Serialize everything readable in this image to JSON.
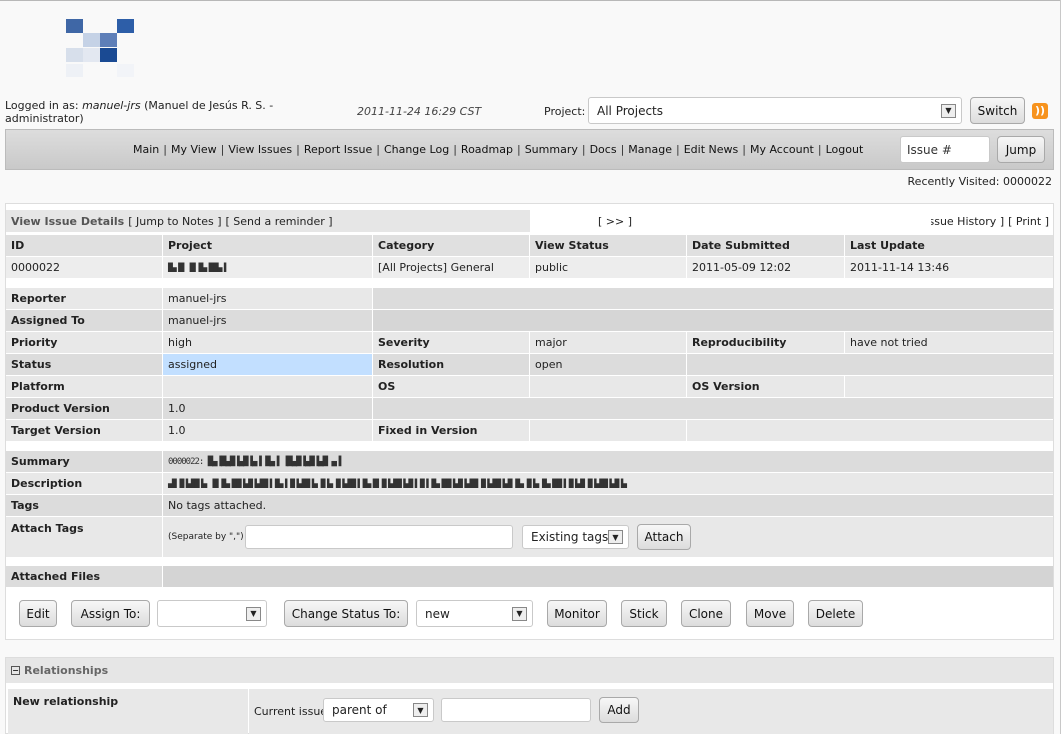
{
  "header": {
    "login_prefix": "Logged in as: ",
    "login_user": "manuel-jrs",
    "login_rest": " (Manuel de Jesús R. S. - administrator)",
    "timestamp": "2011-11-24 16:29 CST",
    "project_label": "Project:",
    "project_selected": "All Projects",
    "switch_label": "Switch"
  },
  "menu": {
    "items": [
      "Main",
      "My View",
      "View Issues",
      "Report Issue",
      "Change Log",
      "Roadmap",
      "Summary",
      "Docs",
      "Manage",
      "Edit News",
      "My Account",
      "Logout"
    ],
    "issue_placeholder": "Issue #",
    "jump_label": "Jump"
  },
  "recently_visited": "Recently Visited: 0000022",
  "issue": {
    "title": "View Issue Details",
    "jump_notes": "[ Jump to Notes ]",
    "send_reminder": "[ Send a reminder ]",
    "nav_next": "[ >> ]",
    "history": "[ Issue History ]",
    "print": "[ Print ]",
    "headers": [
      "ID",
      "Project",
      "Category",
      "View Status",
      "Date Submitted",
      "Last Update"
    ],
    "id": "0000022",
    "project": "█▄▐█ ▐█ █▄▐██▄▐",
    "category": "[All Projects] General",
    "view_status": "public",
    "date_submitted": "2011-05-09 12:02",
    "last_update": "2011-11-14 13:46",
    "labels": {
      "reporter": "Reporter",
      "assigned_to": "Assigned To",
      "priority": "Priority",
      "severity": "Severity",
      "reproducibility": "Reproducibility",
      "status": "Status",
      "resolution": "Resolution",
      "platform": "Platform",
      "os": "OS",
      "os_version": "OS Version",
      "product_version": "Product Version",
      "target_version": "Target Version",
      "fixed_in_version": "Fixed in Version",
      "summary": "Summary",
      "description": "Description",
      "tags": "Tags",
      "attach_tags": "Attach Tags",
      "attached_files": "Attached Files"
    },
    "reporter": "manuel-jrs",
    "assigned_to": "manuel-jrs",
    "priority": "high",
    "severity": "major",
    "reproducibility": "have not tried",
    "status": "assigned",
    "resolution": "open",
    "product_version": "1.0",
    "target_version": "1.0",
    "summary": "0000022: █▄▐█▄█▐▄█▐▄▐ █▄▐ ▐█▄█▐▄█▐▄█ ▄▐",
    "description": "▄█ █▐▄██▐▄ ▐█ █▄▐██▐▄█▐▄██▐ █▄▐ █▐▄██▐▄ █▐▄ █▐▄██▐ █▄▐█ █▐▄██▐▄█▐ █▐ █▄▐██▐▄█▐▄██ █▐▄██▐▄█ █▄ █▐▄ █▄▐██▐ █▐▄█ █▐▄██▐▄█▐▄",
    "tags_value": "No tags attached.",
    "separate_hint": "(Separate by \",\")",
    "existing_tags": "Existing tags",
    "attach_label": "Attach"
  },
  "actions": {
    "edit": "Edit",
    "assign_to": "Assign To:",
    "change_status": "Change Status To:",
    "status_option": "new",
    "monitor": "Monitor",
    "stick": "Stick",
    "clone": "Clone",
    "move": "Move",
    "delete": "Delete"
  },
  "relationships": {
    "title": "Relationships",
    "new_relationship": "New relationship",
    "current_issue": "Current issue",
    "relation_option": "parent of",
    "add_label": "Add"
  },
  "colors": {
    "status_assigned": "#c2dfff",
    "menubar": "#d0d0d0"
  }
}
